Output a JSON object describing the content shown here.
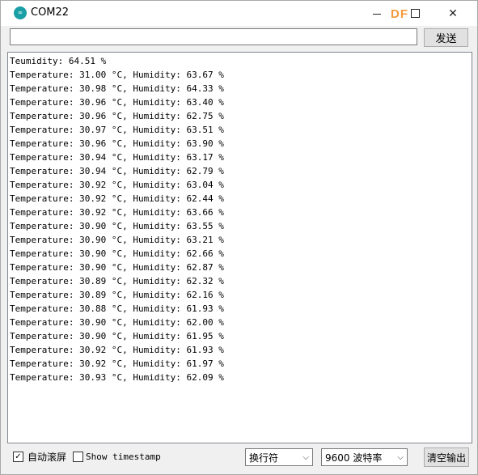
{
  "window": {
    "title": "COM22",
    "icon": "arduino-icon",
    "watermark": "DF"
  },
  "send_bar": {
    "input_value": "",
    "send_label": "发送"
  },
  "output_lines": [
    "Teumidity: 64.51 %",
    "Temperature: 31.00 °C, Humidity: 63.67 %",
    "Temperature: 30.98 °C, Humidity: 64.33 %",
    "Temperature: 30.96 °C, Humidity: 63.40 %",
    "Temperature: 30.96 °C, Humidity: 62.75 %",
    "Temperature: 30.97 °C, Humidity: 63.51 %",
    "Temperature: 30.96 °C, Humidity: 63.90 %",
    "Temperature: 30.94 °C, Humidity: 63.17 %",
    "Temperature: 30.94 °C, Humidity: 62.79 %",
    "Temperature: 30.92 °C, Humidity: 63.04 %",
    "Temperature: 30.92 °C, Humidity: 62.44 %",
    "Temperature: 30.92 °C, Humidity: 63.66 %",
    "Temperature: 30.90 °C, Humidity: 63.55 %",
    "Temperature: 30.90 °C, Humidity: 63.21 %",
    "Temperature: 30.90 °C, Humidity: 62.66 %",
    "Temperature: 30.90 °C, Humidity: 62.87 %",
    "Temperature: 30.89 °C, Humidity: 62.32 %",
    "Temperature: 30.89 °C, Humidity: 62.16 %",
    "Temperature: 30.88 °C, Humidity: 61.93 %",
    "Temperature: 30.90 °C, Humidity: 62.00 %",
    "Temperature: 30.90 °C, Humidity: 61.95 %",
    "Temperature: 30.92 °C, Humidity: 61.93 %",
    "Temperature: 30.92 °C, Humidity: 61.97 %",
    "Temperature: 30.93 °C, Humidity: 62.09 %"
  ],
  "footer": {
    "autoscroll_label": "自动滚屏",
    "autoscroll_checked": true,
    "timestamp_label": "Show timestamp",
    "timestamp_checked": false,
    "line_ending": "换行符",
    "baud_rate": "9600 波特率",
    "clear_label": "清空输出"
  }
}
